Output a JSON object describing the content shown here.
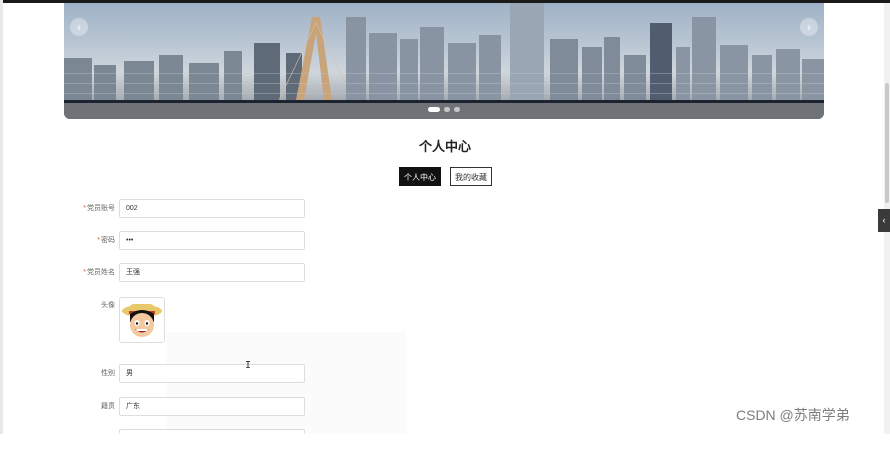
{
  "banner": {
    "prev_icon": "chevron-left-icon",
    "next_icon": "chevron-right-icon",
    "slide_count": 3,
    "active_slide": 1,
    "arrow_prev": "‹",
    "arrow_next": "›"
  },
  "page": {
    "title": "个人中心"
  },
  "tabs": [
    {
      "label": "个人中心",
      "active": true
    },
    {
      "label": "我的收藏",
      "active": false
    }
  ],
  "form": {
    "account": {
      "label": "党员账号",
      "required": true,
      "value": "002"
    },
    "password": {
      "label": "密码",
      "required": true,
      "value": "•••"
    },
    "name": {
      "label": "党员姓名",
      "required": true,
      "value": "王强"
    },
    "avatar": {
      "label": "头像"
    },
    "gender": {
      "label": "性别",
      "value": "男"
    },
    "hometown": {
      "label": "籍贯",
      "value": "广东"
    }
  },
  "side_tab": {
    "icon": "chevron-left-icon",
    "glyph": "‹"
  },
  "watermark": "CSDN @苏南学弟",
  "colors": {
    "accent": "#111111",
    "required": "#e74c3c",
    "input_border": "#dddddd"
  }
}
